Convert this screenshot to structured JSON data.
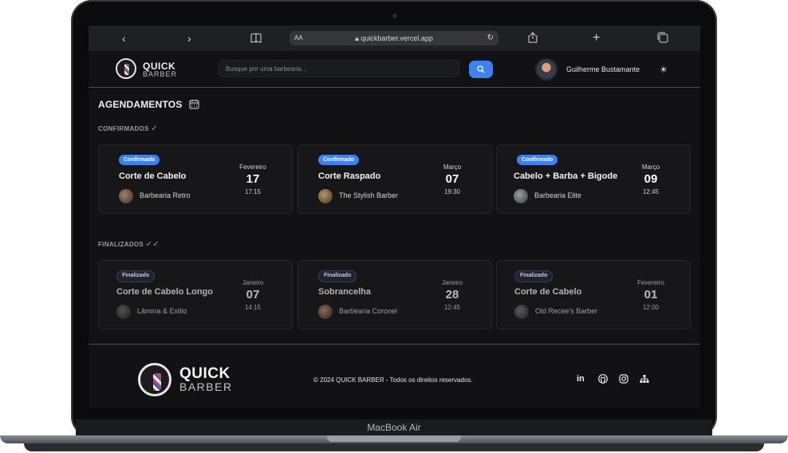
{
  "device": {
    "label": "MacBook Air"
  },
  "browser": {
    "url": "quickbarber.vercel.app",
    "text_size": "AA",
    "icons": [
      "back-icon",
      "forward-icon",
      "book-icon",
      "lock-icon",
      "reload-icon",
      "share-icon",
      "new-tab-icon",
      "tabs-icon"
    ]
  },
  "header": {
    "logo_quick": "QUICK",
    "logo_barber": "BARBER",
    "search_placeholder": "Busque por uma barbearia...",
    "user_name": "Guilherme Bustamante"
  },
  "main": {
    "title": "AGENDAMENTOS",
    "confirmed_label": "CONFIRMADOS",
    "finished_label": "FINALIZADOS",
    "confirmed": [
      {
        "status": "Confirmado",
        "service": "Corte de Cabelo",
        "shop": "Barbearia Retro",
        "month": "Fevereiro",
        "day": "17",
        "time": "17:15"
      },
      {
        "status": "Confirmado",
        "service": "Corte Raspado",
        "shop": "The Stylish Barber",
        "month": "Março",
        "day": "07",
        "time": "19:30"
      },
      {
        "status": "Confirmado",
        "service": "Cabelo + Barba + Bigode",
        "shop": "Barbearia Elite",
        "month": "Março",
        "day": "09",
        "time": "12:45"
      }
    ],
    "finished": [
      {
        "status": "Finalizado",
        "service": "Corte de Cabelo Longo",
        "shop": "Lâmina & Estilo",
        "month": "Janeiro",
        "day": "07",
        "time": "14:15"
      },
      {
        "status": "Finalizado",
        "service": "Sobrancelha",
        "shop": "Barbearia Coronel",
        "month": "Janeiro",
        "day": "28",
        "time": "12:45"
      },
      {
        "status": "Finalizado",
        "service": "Corte de Cabelo",
        "shop": "Old Recee's Barber",
        "month": "Fevereiro",
        "day": "01",
        "time": "12:00"
      }
    ]
  },
  "footer": {
    "logo_quick": "QUICK",
    "logo_barber": "BARBER",
    "copyright": "© 2024 QUICK BARBER - Todos os direitos reservados.",
    "social": {
      "linkedin": "in"
    }
  },
  "colors": {
    "accent": "#3b82f6",
    "background": "#121214",
    "card": "#17171a"
  }
}
